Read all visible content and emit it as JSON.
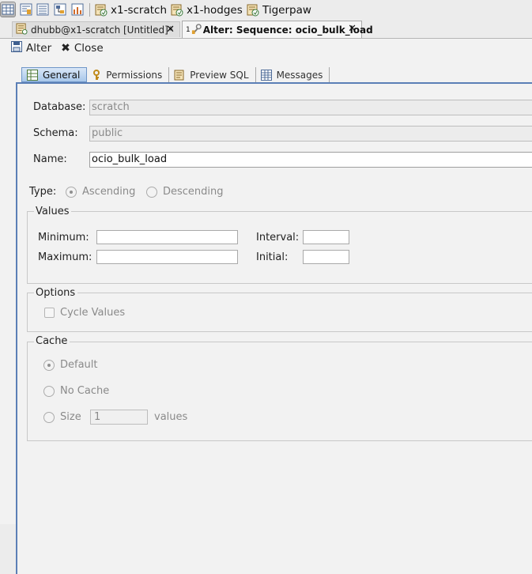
{
  "toolbar": {
    "icons": [
      "grid-icon",
      "table-properties-icon",
      "list-icon",
      "diagram-icon",
      "chart-icon"
    ],
    "connections": [
      {
        "label": "x1-scratch",
        "icon": "database-connection-icon"
      },
      {
        "label": "x1-hodges",
        "icon": "database-connection-icon"
      },
      {
        "label": "Tigerpaw",
        "icon": "database-connection-icon"
      }
    ]
  },
  "tabs": [
    {
      "label": "dhubb@x1-scratch [Untitled]*",
      "close": "✕"
    },
    {
      "prefix": "1",
      "label": "Alter: Sequence: ocio_bulk_load",
      "close": "✕"
    }
  ],
  "actions": {
    "alter": "Alter",
    "close": "Close"
  },
  "subtabs": [
    "General",
    "Permissions",
    "Preview SQL",
    "Messages"
  ],
  "form": {
    "database_label": "Database:",
    "database_value": "scratch",
    "schema_label": "Schema:",
    "schema_value": "public",
    "name_label": "Name:",
    "name_value": "ocio_bulk_load",
    "type_label": "Type:",
    "type_ascending": "Ascending",
    "type_descending": "Descending",
    "type_selected": "Ascending"
  },
  "values": {
    "title": "Values",
    "minimum_label": "Minimum:",
    "maximum_label": "Maximum:",
    "interval_label": "Interval:",
    "initial_label": "Initial:",
    "minimum": "",
    "maximum": "",
    "interval": "",
    "initial": ""
  },
  "options": {
    "title": "Options",
    "cycle_values": "Cycle Values",
    "cycle_checked": false
  },
  "cache": {
    "title": "Cache",
    "default_label": "Default",
    "no_cache_label": "No Cache",
    "size_label": "Size",
    "size_value": "1",
    "size_suffix": "values",
    "selected": "Default"
  },
  "colors": {
    "active_tab_accent": "#5b7fb6",
    "selected_subtab": "#a8c7ea"
  }
}
